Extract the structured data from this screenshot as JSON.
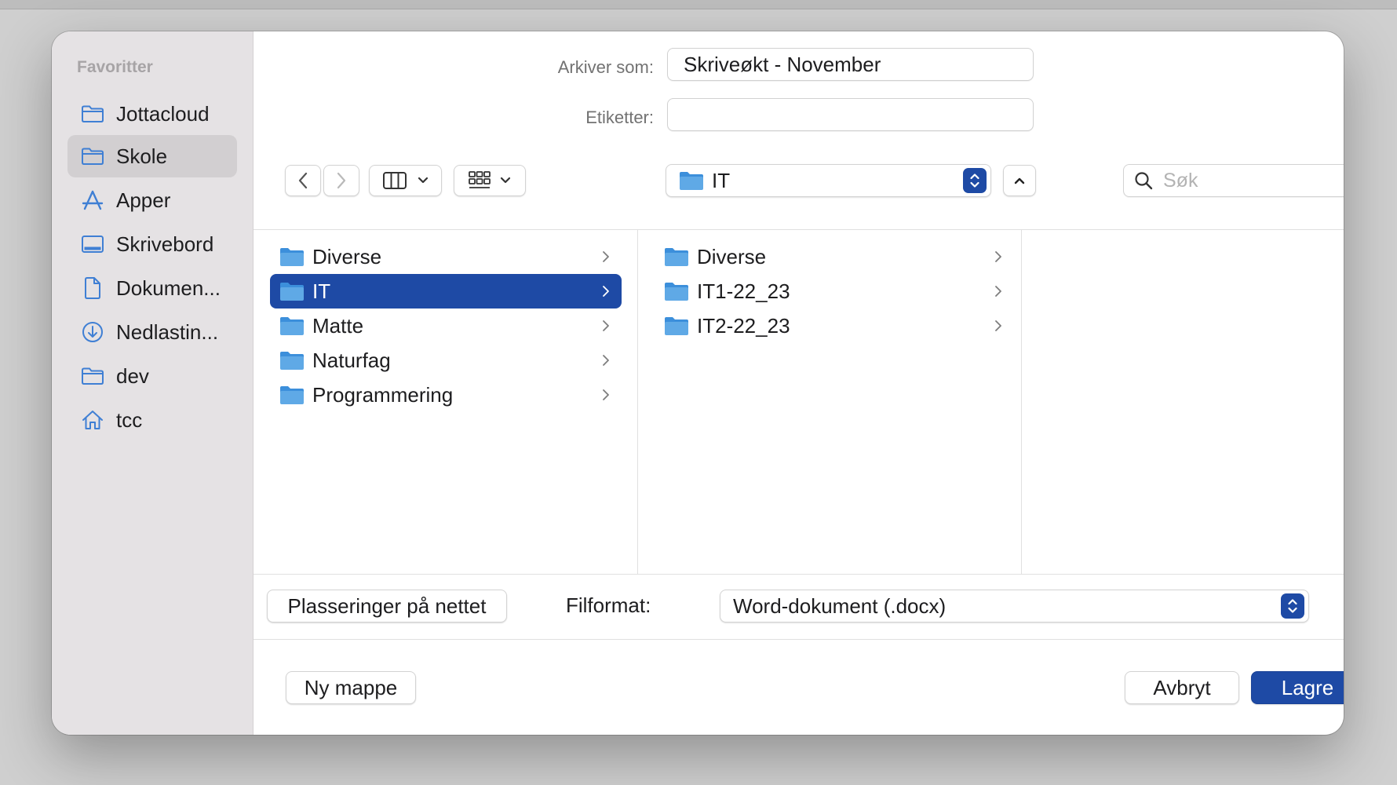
{
  "sidebar": {
    "heading": "Favoritter",
    "items": [
      {
        "label": "Jottacloud",
        "icon": "folder-icon"
      },
      {
        "label": "Skole",
        "icon": "folder-icon",
        "selected": true
      },
      {
        "label": "Apper",
        "icon": "apps-icon"
      },
      {
        "label": "Skrivebord",
        "icon": "desktop-icon"
      },
      {
        "label": "Dokumen...",
        "icon": "document-icon"
      },
      {
        "label": "Nedlastin...",
        "icon": "download-icon"
      },
      {
        "label": "dev",
        "icon": "folder-icon"
      },
      {
        "label": "tcc",
        "icon": "home-icon"
      }
    ]
  },
  "form": {
    "save_as_label": "Arkiver som:",
    "save_as_value": "Skriveøkt - November",
    "tags_label": "Etiketter:",
    "tags_value": ""
  },
  "toolbar": {
    "location": "IT",
    "search_placeholder": "Søk"
  },
  "browser": {
    "column1": [
      {
        "name": "Diverse"
      },
      {
        "name": "IT",
        "selected": true
      },
      {
        "name": "Matte"
      },
      {
        "name": "Naturfag"
      },
      {
        "name": "Programmering"
      }
    ],
    "column2": [
      {
        "name": "Diverse"
      },
      {
        "name": "IT1-22_23"
      },
      {
        "name": "IT2-22_23"
      }
    ]
  },
  "footer": {
    "network_button": "Plasseringer på nettet",
    "format_label": "Filformat:",
    "format_value": "Word-dokument (.docx)",
    "new_folder_button": "Ny mappe",
    "cancel_button": "Avbryt",
    "save_button": "Lagre"
  },
  "colors": {
    "accent": "#1e4aa5",
    "sidebar_bg": "#e5e2e4",
    "sidebar_selected": "#d2cfd1",
    "folder_blue": "#5fa9e6",
    "sidebar_icon": "#3f7fd4"
  }
}
